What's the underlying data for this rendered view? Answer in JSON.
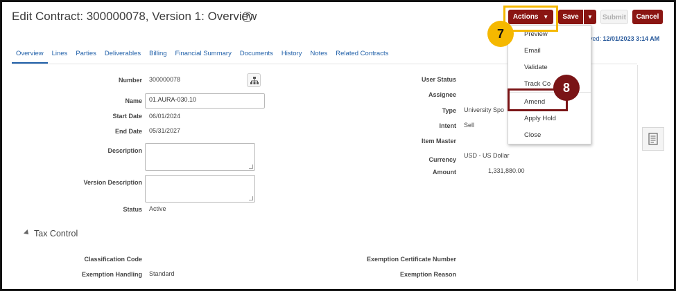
{
  "header": {
    "title": "Edit Contract: 300000078, Version 1: Overview",
    "help_icon": "?",
    "saved_label": "ved:",
    "saved_value": "12/01/2023 3:14 AM"
  },
  "toolbar": {
    "actions_label": "Actions",
    "save_label": "Save",
    "submit_label": "Submit",
    "cancel_label": "Cancel"
  },
  "tabs": [
    {
      "label": "Overview"
    },
    {
      "label": "Lines"
    },
    {
      "label": "Parties"
    },
    {
      "label": "Deliverables"
    },
    {
      "label": "Billing"
    },
    {
      "label": "Financial Summary"
    },
    {
      "label": "Documents"
    },
    {
      "label": "History"
    },
    {
      "label": "Notes"
    },
    {
      "label": "Related Contracts"
    }
  ],
  "form": {
    "number_label": "Number",
    "number_value": "300000078",
    "name_label": "Name",
    "name_value": "01.AURA-030.10",
    "start_date_label": "Start Date",
    "start_date_value": "06/01/2024",
    "end_date_label": "End Date",
    "end_date_value": "05/31/2027",
    "description_label": "Description",
    "description_value": "",
    "version_description_label": "Version Description",
    "version_description_value": "",
    "status_label": "Status",
    "status_value": "Active",
    "user_status_label": "User Status",
    "assignee_label": "Assignee",
    "type_label": "Type",
    "type_value": "University Spo",
    "intent_label": "Intent",
    "intent_value": "Sell",
    "item_master_label": "Item Master",
    "currency_label": "Currency",
    "currency_value": "USD - US Dollar",
    "amount_label": "Amount",
    "amount_value": "1,331,880.00"
  },
  "tax_control": {
    "title": "Tax Control",
    "classification_code_label": "Classification Code",
    "exemption_handling_label": "Exemption Handling",
    "exemption_handling_value": "Standard",
    "exemption_certificate_label": "Exemption Certificate Number",
    "exemption_reason_label": "Exemption Reason"
  },
  "actions_menu": {
    "items": [
      {
        "label": "Preview"
      },
      {
        "label": "Email"
      },
      {
        "label": "Validate"
      },
      {
        "label": "Track Co"
      },
      {
        "label": "Amend"
      },
      {
        "label": "Apply Hold"
      },
      {
        "label": "Close"
      }
    ]
  },
  "callouts": {
    "step7": "7",
    "step8": "8"
  },
  "colors": {
    "brand_button": "#8a1512",
    "highlight_yellow": "#f5b800",
    "callout_dark_red": "#7a1416",
    "link_blue": "#1f5fa8"
  }
}
